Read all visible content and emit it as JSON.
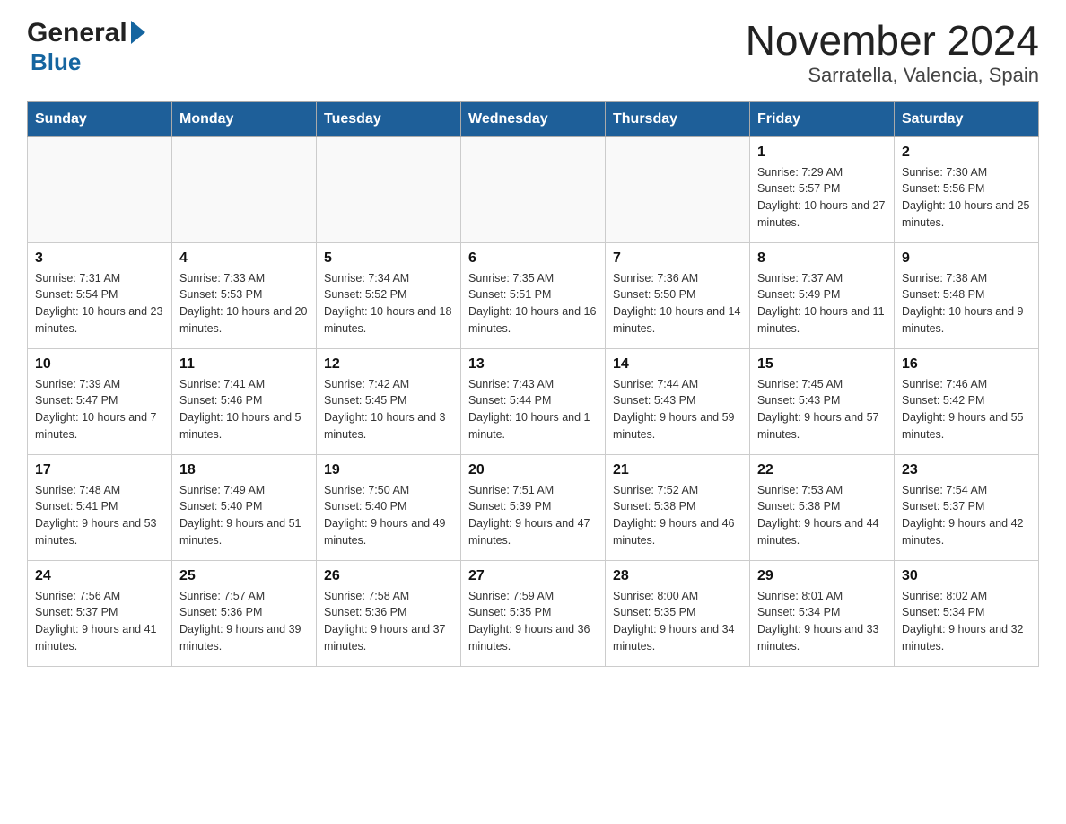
{
  "logo": {
    "general": "General",
    "blue": "Blue"
  },
  "title": "November 2024",
  "subtitle": "Sarratella, Valencia, Spain",
  "weekdays": [
    "Sunday",
    "Monday",
    "Tuesday",
    "Wednesday",
    "Thursday",
    "Friday",
    "Saturday"
  ],
  "weeks": [
    [
      {
        "day": "",
        "info": ""
      },
      {
        "day": "",
        "info": ""
      },
      {
        "day": "",
        "info": ""
      },
      {
        "day": "",
        "info": ""
      },
      {
        "day": "",
        "info": ""
      },
      {
        "day": "1",
        "info": "Sunrise: 7:29 AM\nSunset: 5:57 PM\nDaylight: 10 hours and 27 minutes."
      },
      {
        "day": "2",
        "info": "Sunrise: 7:30 AM\nSunset: 5:56 PM\nDaylight: 10 hours and 25 minutes."
      }
    ],
    [
      {
        "day": "3",
        "info": "Sunrise: 7:31 AM\nSunset: 5:54 PM\nDaylight: 10 hours and 23 minutes."
      },
      {
        "day": "4",
        "info": "Sunrise: 7:33 AM\nSunset: 5:53 PM\nDaylight: 10 hours and 20 minutes."
      },
      {
        "day": "5",
        "info": "Sunrise: 7:34 AM\nSunset: 5:52 PM\nDaylight: 10 hours and 18 minutes."
      },
      {
        "day": "6",
        "info": "Sunrise: 7:35 AM\nSunset: 5:51 PM\nDaylight: 10 hours and 16 minutes."
      },
      {
        "day": "7",
        "info": "Sunrise: 7:36 AM\nSunset: 5:50 PM\nDaylight: 10 hours and 14 minutes."
      },
      {
        "day": "8",
        "info": "Sunrise: 7:37 AM\nSunset: 5:49 PM\nDaylight: 10 hours and 11 minutes."
      },
      {
        "day": "9",
        "info": "Sunrise: 7:38 AM\nSunset: 5:48 PM\nDaylight: 10 hours and 9 minutes."
      }
    ],
    [
      {
        "day": "10",
        "info": "Sunrise: 7:39 AM\nSunset: 5:47 PM\nDaylight: 10 hours and 7 minutes."
      },
      {
        "day": "11",
        "info": "Sunrise: 7:41 AM\nSunset: 5:46 PM\nDaylight: 10 hours and 5 minutes."
      },
      {
        "day": "12",
        "info": "Sunrise: 7:42 AM\nSunset: 5:45 PM\nDaylight: 10 hours and 3 minutes."
      },
      {
        "day": "13",
        "info": "Sunrise: 7:43 AM\nSunset: 5:44 PM\nDaylight: 10 hours and 1 minute."
      },
      {
        "day": "14",
        "info": "Sunrise: 7:44 AM\nSunset: 5:43 PM\nDaylight: 9 hours and 59 minutes."
      },
      {
        "day": "15",
        "info": "Sunrise: 7:45 AM\nSunset: 5:43 PM\nDaylight: 9 hours and 57 minutes."
      },
      {
        "day": "16",
        "info": "Sunrise: 7:46 AM\nSunset: 5:42 PM\nDaylight: 9 hours and 55 minutes."
      }
    ],
    [
      {
        "day": "17",
        "info": "Sunrise: 7:48 AM\nSunset: 5:41 PM\nDaylight: 9 hours and 53 minutes."
      },
      {
        "day": "18",
        "info": "Sunrise: 7:49 AM\nSunset: 5:40 PM\nDaylight: 9 hours and 51 minutes."
      },
      {
        "day": "19",
        "info": "Sunrise: 7:50 AM\nSunset: 5:40 PM\nDaylight: 9 hours and 49 minutes."
      },
      {
        "day": "20",
        "info": "Sunrise: 7:51 AM\nSunset: 5:39 PM\nDaylight: 9 hours and 47 minutes."
      },
      {
        "day": "21",
        "info": "Sunrise: 7:52 AM\nSunset: 5:38 PM\nDaylight: 9 hours and 46 minutes."
      },
      {
        "day": "22",
        "info": "Sunrise: 7:53 AM\nSunset: 5:38 PM\nDaylight: 9 hours and 44 minutes."
      },
      {
        "day": "23",
        "info": "Sunrise: 7:54 AM\nSunset: 5:37 PM\nDaylight: 9 hours and 42 minutes."
      }
    ],
    [
      {
        "day": "24",
        "info": "Sunrise: 7:56 AM\nSunset: 5:37 PM\nDaylight: 9 hours and 41 minutes."
      },
      {
        "day": "25",
        "info": "Sunrise: 7:57 AM\nSunset: 5:36 PM\nDaylight: 9 hours and 39 minutes."
      },
      {
        "day": "26",
        "info": "Sunrise: 7:58 AM\nSunset: 5:36 PM\nDaylight: 9 hours and 37 minutes."
      },
      {
        "day": "27",
        "info": "Sunrise: 7:59 AM\nSunset: 5:35 PM\nDaylight: 9 hours and 36 minutes."
      },
      {
        "day": "28",
        "info": "Sunrise: 8:00 AM\nSunset: 5:35 PM\nDaylight: 9 hours and 34 minutes."
      },
      {
        "day": "29",
        "info": "Sunrise: 8:01 AM\nSunset: 5:34 PM\nDaylight: 9 hours and 33 minutes."
      },
      {
        "day": "30",
        "info": "Sunrise: 8:02 AM\nSunset: 5:34 PM\nDaylight: 9 hours and 32 minutes."
      }
    ]
  ]
}
